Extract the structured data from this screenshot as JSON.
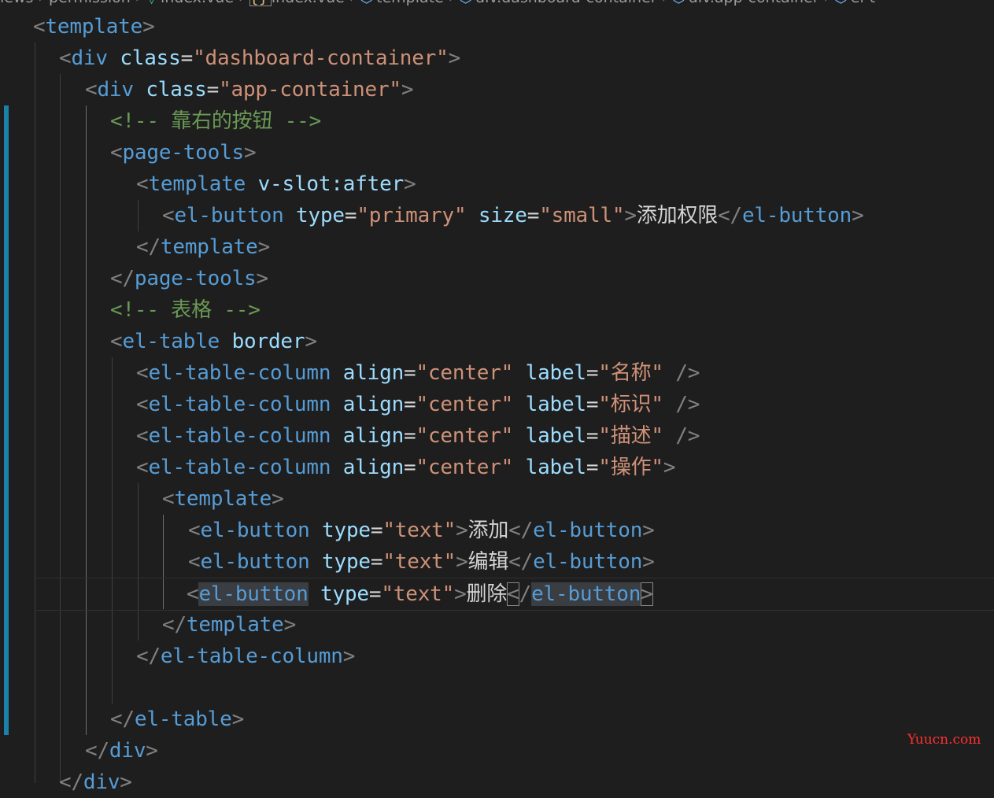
{
  "breadcrumb": {
    "items": [
      {
        "icon": "",
        "text": "iews"
      },
      {
        "icon": "",
        "text": "permission"
      },
      {
        "icon": "vue",
        "text": "index.vue"
      },
      {
        "icon": "{}",
        "text": "index.vue"
      },
      {
        "icon": "cube",
        "text": "template"
      },
      {
        "icon": "cube",
        "text": "div.dashboard-container"
      },
      {
        "icon": "cube",
        "text": "div.app-container"
      },
      {
        "icon": "cube",
        "text": "el-t"
      }
    ]
  },
  "code": {
    "lines": [
      [
        [
          "p",
          "<"
        ],
        [
          "t",
          "template"
        ],
        [
          "p",
          ">"
        ]
      ],
      [
        [
          "p",
          "<"
        ],
        [
          "t",
          "div"
        ],
        [
          "x",
          " "
        ],
        [
          "a",
          "class"
        ],
        [
          "x",
          "="
        ],
        [
          "s",
          "\"dashboard-container\""
        ],
        [
          "p",
          ">"
        ]
      ],
      [
        [
          "p",
          "<"
        ],
        [
          "t",
          "div"
        ],
        [
          "x",
          " "
        ],
        [
          "a",
          "class"
        ],
        [
          "x",
          "="
        ],
        [
          "s",
          "\"app-container\""
        ],
        [
          "p",
          ">"
        ]
      ],
      [
        [
          "c",
          "<!-- 靠右的按钮 -->"
        ]
      ],
      [
        [
          "p",
          "<"
        ],
        [
          "t",
          "page-tools"
        ],
        [
          "p",
          ">"
        ]
      ],
      [
        [
          "p",
          "<"
        ],
        [
          "t",
          "template"
        ],
        [
          "x",
          " "
        ],
        [
          "a",
          "v-slot:after"
        ],
        [
          "p",
          ">"
        ]
      ],
      [
        [
          "p",
          "<"
        ],
        [
          "t",
          "el-button"
        ],
        [
          "x",
          " "
        ],
        [
          "a",
          "type"
        ],
        [
          "x",
          "="
        ],
        [
          "s",
          "\"primary\""
        ],
        [
          "x",
          " "
        ],
        [
          "a",
          "size"
        ],
        [
          "x",
          "="
        ],
        [
          "s",
          "\"small\""
        ],
        [
          "p",
          ">"
        ],
        [
          "x",
          "添加权限"
        ],
        [
          "p",
          "</"
        ],
        [
          "t",
          "el-button"
        ],
        [
          "p",
          ">"
        ]
      ],
      [
        [
          "p",
          "</"
        ],
        [
          "t",
          "template"
        ],
        [
          "p",
          ">"
        ]
      ],
      [
        [
          "p",
          "</"
        ],
        [
          "t",
          "page-tools"
        ],
        [
          "p",
          ">"
        ]
      ],
      [
        [
          "c",
          "<!-- 表格 -->"
        ]
      ],
      [
        [
          "p",
          "<"
        ],
        [
          "t",
          "el-table"
        ],
        [
          "x",
          " "
        ],
        [
          "a",
          "border"
        ],
        [
          "p",
          ">"
        ]
      ],
      [
        [
          "p",
          "<"
        ],
        [
          "t",
          "el-table-column"
        ],
        [
          "x",
          " "
        ],
        [
          "a",
          "align"
        ],
        [
          "x",
          "="
        ],
        [
          "s",
          "\"center\""
        ],
        [
          "x",
          " "
        ],
        [
          "a",
          "label"
        ],
        [
          "x",
          "="
        ],
        [
          "s",
          "\"名称\""
        ],
        [
          "x",
          " "
        ],
        [
          "p",
          "/>"
        ]
      ],
      [
        [
          "p",
          "<"
        ],
        [
          "t",
          "el-table-column"
        ],
        [
          "x",
          " "
        ],
        [
          "a",
          "align"
        ],
        [
          "x",
          "="
        ],
        [
          "s",
          "\"center\""
        ],
        [
          "x",
          " "
        ],
        [
          "a",
          "label"
        ],
        [
          "x",
          "="
        ],
        [
          "s",
          "\"标识\""
        ],
        [
          "x",
          " "
        ],
        [
          "p",
          "/>"
        ]
      ],
      [
        [
          "p",
          "<"
        ],
        [
          "t",
          "el-table-column"
        ],
        [
          "x",
          " "
        ],
        [
          "a",
          "align"
        ],
        [
          "x",
          "="
        ],
        [
          "s",
          "\"center\""
        ],
        [
          "x",
          " "
        ],
        [
          "a",
          "label"
        ],
        [
          "x",
          "="
        ],
        [
          "s",
          "\"描述\""
        ],
        [
          "x",
          " "
        ],
        [
          "p",
          "/>"
        ]
      ],
      [
        [
          "p",
          "<"
        ],
        [
          "t",
          "el-table-column"
        ],
        [
          "x",
          " "
        ],
        [
          "a",
          "align"
        ],
        [
          "x",
          "="
        ],
        [
          "s",
          "\"center\""
        ],
        [
          "x",
          " "
        ],
        [
          "a",
          "label"
        ],
        [
          "x",
          "="
        ],
        [
          "s",
          "\"操作\""
        ],
        [
          "p",
          ">"
        ]
      ],
      [
        [
          "p",
          "<"
        ],
        [
          "t",
          "template"
        ],
        [
          "p",
          ">"
        ]
      ],
      [
        [
          "p",
          "<"
        ],
        [
          "t",
          "el-button"
        ],
        [
          "x",
          " "
        ],
        [
          "a",
          "type"
        ],
        [
          "x",
          "="
        ],
        [
          "s",
          "\"text\""
        ],
        [
          "p",
          ">"
        ],
        [
          "x",
          "添加"
        ],
        [
          "p",
          "</"
        ],
        [
          "t",
          "el-button"
        ],
        [
          "p",
          ">"
        ]
      ],
      [
        [
          "p",
          "<"
        ],
        [
          "t",
          "el-button"
        ],
        [
          "x",
          " "
        ],
        [
          "a",
          "type"
        ],
        [
          "x",
          "="
        ],
        [
          "s",
          "\"text\""
        ],
        [
          "p",
          ">"
        ],
        [
          "x",
          "编辑"
        ],
        [
          "p",
          "</"
        ],
        [
          "t",
          "el-button"
        ],
        [
          "p",
          ">"
        ]
      ],
      [
        [
          "p",
          "<"
        ],
        [
          "t hl",
          "el-button"
        ],
        [
          "x",
          " "
        ],
        [
          "a",
          "type"
        ],
        [
          "x",
          "="
        ],
        [
          "s",
          "\"text\""
        ],
        [
          "p",
          ">"
        ],
        [
          "x",
          "删除"
        ],
        [
          "p br",
          "<"
        ],
        [
          "p",
          "/"
        ],
        [
          "t hl",
          "el-button"
        ],
        [
          "p br",
          ">"
        ]
      ],
      [
        [
          "p",
          "</"
        ],
        [
          "t",
          "template"
        ],
        [
          "p",
          ">"
        ]
      ],
      [
        [
          "p",
          "</"
        ],
        [
          "t",
          "el-table-column"
        ],
        [
          "p",
          ">"
        ]
      ],
      [],
      [
        [
          "p",
          "</"
        ],
        [
          "t",
          "el-table"
        ],
        [
          "p",
          ">"
        ]
      ],
      [
        [
          "p",
          "</"
        ],
        [
          "t",
          "div"
        ],
        [
          "p",
          ">"
        ]
      ],
      [
        [
          "p",
          "</"
        ],
        [
          "t",
          "div"
        ],
        [
          "p",
          ">"
        ]
      ]
    ]
  },
  "watermark": "Yuucn.com"
}
